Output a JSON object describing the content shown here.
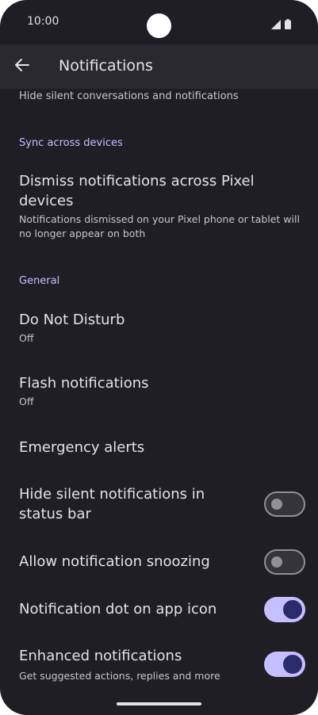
{
  "status_bar": {
    "time": "10:00"
  },
  "app_bar": {
    "title": "Notifications"
  },
  "truncated_subtitle": "Hide silent conversations and notifications",
  "sections": {
    "sync": {
      "header": "Sync across devices",
      "dismiss_title": "Dismiss notifications across Pixel devices",
      "dismiss_sub": "Notifications dismissed on your Pixel phone or tablet will no longer appear on both"
    },
    "general": {
      "header": "General",
      "dnd_title": "Do Not Disturb",
      "dnd_sub": "Off",
      "flash_title": "Flash notifications",
      "flash_sub": "Off",
      "emergency_title": "Emergency alerts",
      "hide_silent_title": "Hide silent notifications in status bar",
      "hide_silent_on": false,
      "snooze_title": "Allow notification snoozing",
      "snooze_on": false,
      "dot_title": "Notification dot on app icon",
      "dot_on": true,
      "enhanced_title": "Enhanced notifications",
      "enhanced_sub": "Get suggested actions, replies and more",
      "enhanced_on": true
    }
  },
  "colors": {
    "background": "#1f1e24",
    "app_bar": "#2a2930",
    "accent": "#c6bfff",
    "toggle_knob_on": "#2b2a6b",
    "text_primary": "#e6e1e9",
    "text_secondary": "#c9c4d0"
  },
  "icons": {
    "back": "arrow-back-icon",
    "signal": "cell-signal-icon",
    "battery": "battery-icon"
  }
}
